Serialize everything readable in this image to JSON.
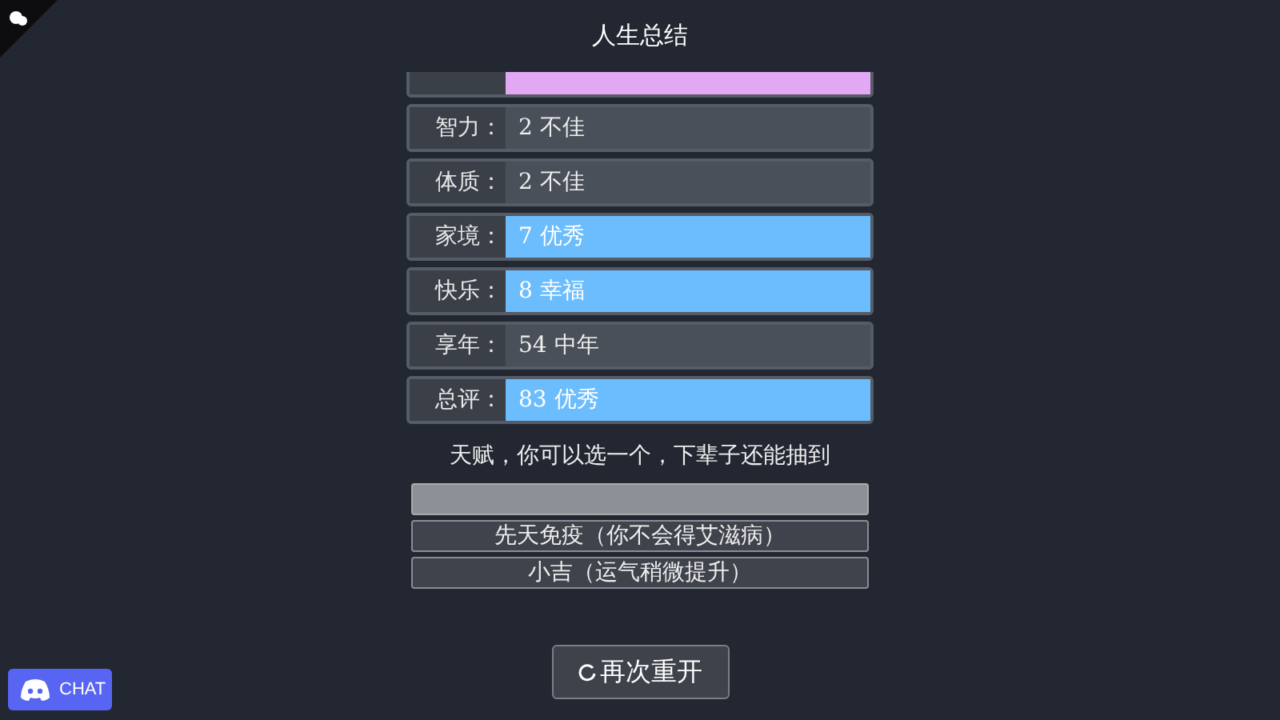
{
  "title": "人生总结",
  "stats": [
    {
      "color": "#e2a8f4"
    },
    {
      "label": "智力：",
      "value": "2 不佳"
    },
    {
      "label": "体质：",
      "value": "2 不佳"
    },
    {
      "label": "家境：",
      "value": "7 优秀",
      "color": "#6cbdfd"
    },
    {
      "label": "快乐：",
      "value": "8 幸福",
      "color": "#6cbdfd"
    },
    {
      "label": "享年：",
      "value": "54 中年"
    },
    {
      "label": "总评：",
      "value": "83 优秀",
      "color": "#6cbdfd"
    }
  ],
  "talent_prompt": "天赋，你可以选一个，下辈子还能抽到",
  "talents": [
    {
      "selected": true
    },
    {
      "label": "先天免疫（你不会得艾滋病）",
      "selected": false
    },
    {
      "label": "小吉（运气稍微提升）",
      "selected": false
    }
  ],
  "restart_button": "再次重开",
  "chat_button": "CHAT"
}
